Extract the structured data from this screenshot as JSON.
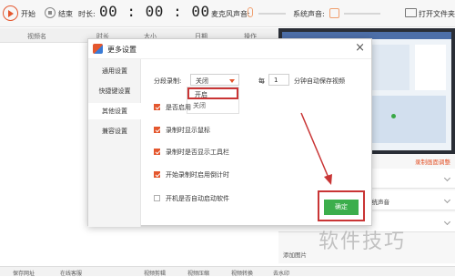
{
  "toolbar": {
    "start_label": "开始",
    "stop_label": "结束",
    "duration_label": "时长:",
    "timer": "00 : 00 : 00",
    "mic_label": "麦克风声音:",
    "system_label": "系统声音:",
    "open_folder_label": "打开文件夹"
  },
  "list_header": [
    "视频名",
    "时长",
    "大小",
    "日期",
    "操作"
  ],
  "dialog": {
    "title": "更多设置",
    "close": "×",
    "nav": [
      "通用设置",
      "快捷键设置",
      "其他设置",
      "兼容设置"
    ],
    "segment_label": "分段录制:",
    "segment_value": "关闭",
    "dropdown_options": [
      "开启",
      "关闭"
    ],
    "every_label": "每",
    "minutes_value": "1",
    "minutes_suffix": "分钟自动保存视频",
    "options": [
      {
        "label": "是否启用",
        "checked": true
      },
      {
        "label": "录制时显示鼠标",
        "checked": true
      },
      {
        "label": "录制时是否显示工具栏",
        "checked": true
      },
      {
        "label": "开始录制时启用倒计时",
        "checked": true
      },
      {
        "label": "开机是否自动启动软件",
        "checked": false
      }
    ],
    "ok_label": "确定"
  },
  "right_panel": {
    "link_label": "录制画面调整",
    "system_sound_label": "系统声音",
    "add_label": "添加图片"
  },
  "bottom_bar": [
    "保存网址",
    "在线客服",
    "视频剪辑",
    "视频压缩",
    "视频转换",
    "去水印"
  ],
  "watermark": "软件技巧",
  "colors": {
    "accent": "#e4572e",
    "ok_green": "#3cae4c",
    "highlight": "#c93535"
  }
}
